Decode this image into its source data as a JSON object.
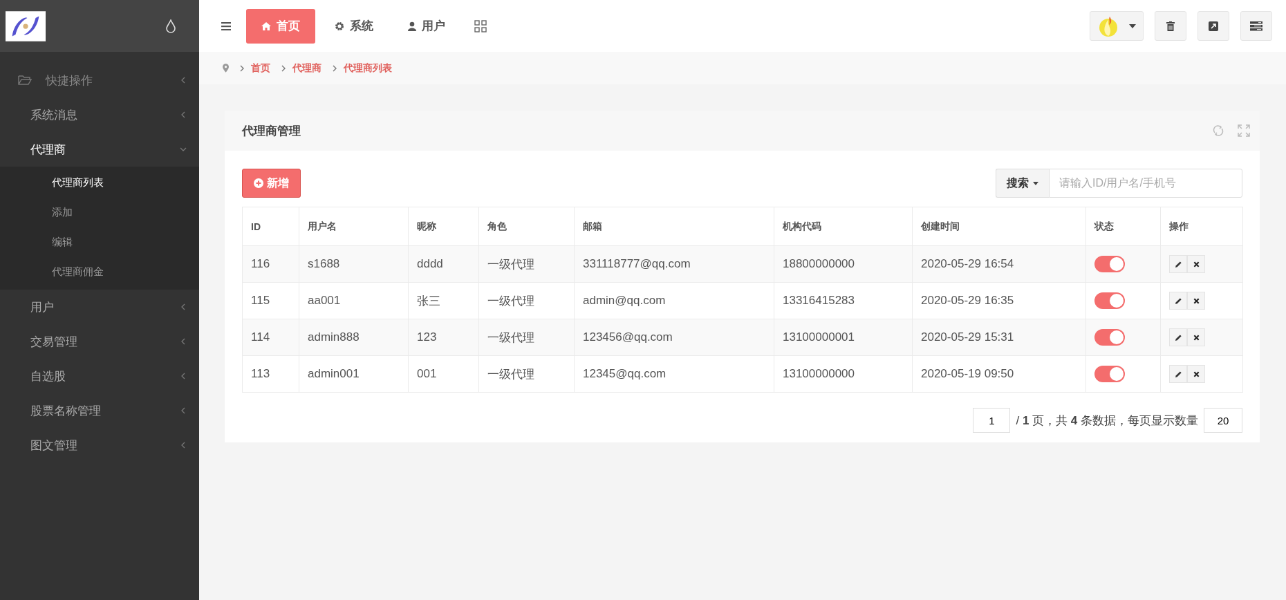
{
  "sidebar": {
    "items": [
      {
        "label": "快捷操作",
        "kind": "shortcut",
        "expanded": false
      },
      {
        "label": "系统消息",
        "kind": "menu",
        "expanded": false
      },
      {
        "label": "代理商",
        "kind": "menu",
        "expanded": true,
        "children": [
          {
            "label": "代理商列表",
            "selected": true
          },
          {
            "label": "添加",
            "selected": false
          },
          {
            "label": "编辑",
            "selected": false
          },
          {
            "label": "代理商佣金",
            "selected": false
          }
        ]
      },
      {
        "label": "用户",
        "kind": "menu",
        "expanded": false
      },
      {
        "label": "交易管理",
        "kind": "menu",
        "expanded": false
      },
      {
        "label": "自选股",
        "kind": "menu",
        "expanded": false
      },
      {
        "label": "股票名称管理",
        "kind": "menu",
        "expanded": false
      },
      {
        "label": "图文管理",
        "kind": "menu",
        "expanded": false
      }
    ]
  },
  "tabs": [
    {
      "label": "首页",
      "selected": true
    },
    {
      "label": "系统",
      "selected": false
    },
    {
      "label": "用户",
      "selected": false
    }
  ],
  "breadcrumb": [
    "首页",
    "代理商",
    "代理商列表"
  ],
  "panel": {
    "title": "代理商管理",
    "add_button": "新增",
    "search": {
      "button": "搜索",
      "placeholder": "请输入ID/用户名/手机号"
    },
    "table": {
      "columns": [
        "ID",
        "用户名",
        "昵称",
        "角色",
        "邮箱",
        "机构代码",
        "创建时间",
        "状态",
        "操作"
      ],
      "rows": [
        {
          "cells": [
            "116",
            "s1688",
            "dddd",
            "一级代理",
            "331118777@qq.com",
            "18800000000",
            "2020-05-29 16:54"
          ],
          "on": true
        },
        {
          "cells": [
            "115",
            "aa001",
            "张三",
            "一级代理",
            "admin@qq.com",
            "13316415283",
            "2020-05-29 16:35"
          ],
          "on": true
        },
        {
          "cells": [
            "114",
            "admin888",
            "123",
            "一级代理",
            "123456@qq.com",
            "13100000001",
            "2020-05-29 15:31"
          ],
          "on": true
        },
        {
          "cells": [
            "113",
            "admin001",
            "001",
            "一级代理",
            "12345@qq.com",
            "13100000000",
            "2020-05-19 09:50"
          ],
          "on": true
        }
      ]
    },
    "pagination": {
      "page": "1",
      "summary": "/ **1** 页，共 **4** 条数据，每页显示数量",
      "page_size": "20"
    }
  }
}
